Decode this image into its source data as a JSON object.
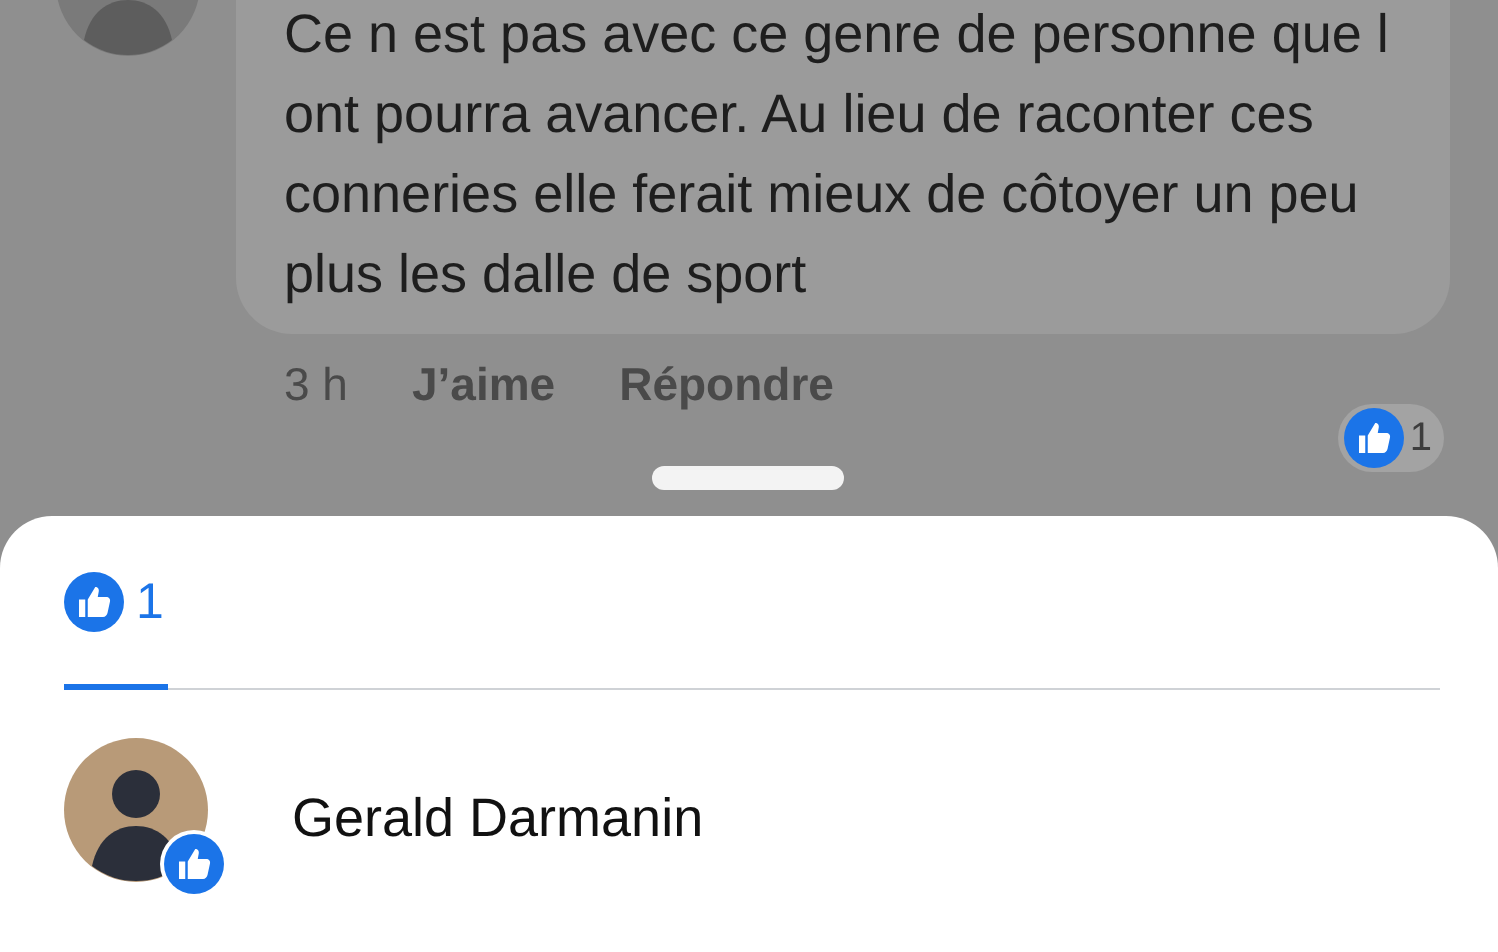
{
  "comment": {
    "text": "Ce n est pas avec ce genre de personne que l ont pourra avancer. Au lieu de raconter ces conneries elle ferait mieux de côtoyer un peu plus les dalle de sport",
    "time": "3 h",
    "actions": [
      "J’aime",
      "Répondre"
    ],
    "reaction_count": "1"
  },
  "sheet": {
    "tabs": [
      {
        "count": "1",
        "selected": true
      }
    ],
    "people": [
      {
        "name": "Gerald Darmanin"
      }
    ]
  }
}
